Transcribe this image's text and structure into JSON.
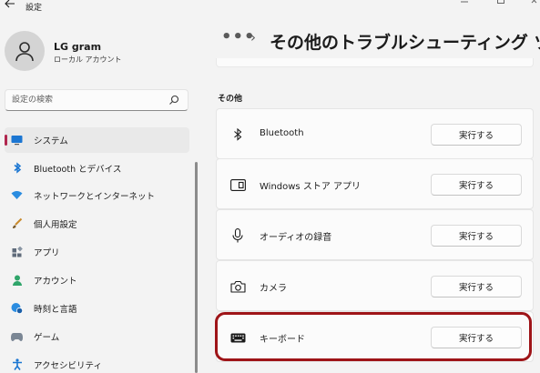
{
  "window": {
    "title": "設定"
  },
  "user": {
    "name": "LG gram",
    "account_type": "ローカル アカウント"
  },
  "search": {
    "placeholder": "設定の検索"
  },
  "nav": {
    "items": [
      {
        "label": "システム",
        "icon": "monitor-icon",
        "active": true
      },
      {
        "label": "Bluetooth とデバイス",
        "icon": "bluetooth-icon"
      },
      {
        "label": "ネットワークとインターネット",
        "icon": "wifi-icon"
      },
      {
        "label": "個人用設定",
        "icon": "brush-icon"
      },
      {
        "label": "アプリ",
        "icon": "apps-icon"
      },
      {
        "label": "アカウント",
        "icon": "person-icon"
      },
      {
        "label": "時刻と言語",
        "icon": "globe-clock-icon"
      },
      {
        "label": "ゲーム",
        "icon": "gamepad-icon"
      },
      {
        "label": "アクセシビリティ",
        "icon": "accessibility-icon"
      }
    ]
  },
  "breadcrumb": {
    "more": "•••",
    "separator": "›"
  },
  "page": {
    "title": "その他のトラブルシューティング ツール"
  },
  "section": {
    "label": "その他"
  },
  "troubleshooters": [
    {
      "label": "Bluetooth",
      "icon": "bluetooth-icon",
      "button": "実行する"
    },
    {
      "label": "Windows ストア アプリ",
      "icon": "store-app-icon",
      "button": "実行する"
    },
    {
      "label": "オーディオの録音",
      "icon": "microphone-icon",
      "button": "実行する"
    },
    {
      "label": "カメラ",
      "icon": "camera-icon",
      "button": "実行する"
    },
    {
      "label": "キーボード",
      "icon": "keyboard-icon",
      "button": "実行する",
      "highlighted": true
    }
  ],
  "colors": {
    "accent": "#b0264e",
    "highlight": "#9e1418",
    "background": "#f3f3f3",
    "card": "#fbfbfb"
  }
}
